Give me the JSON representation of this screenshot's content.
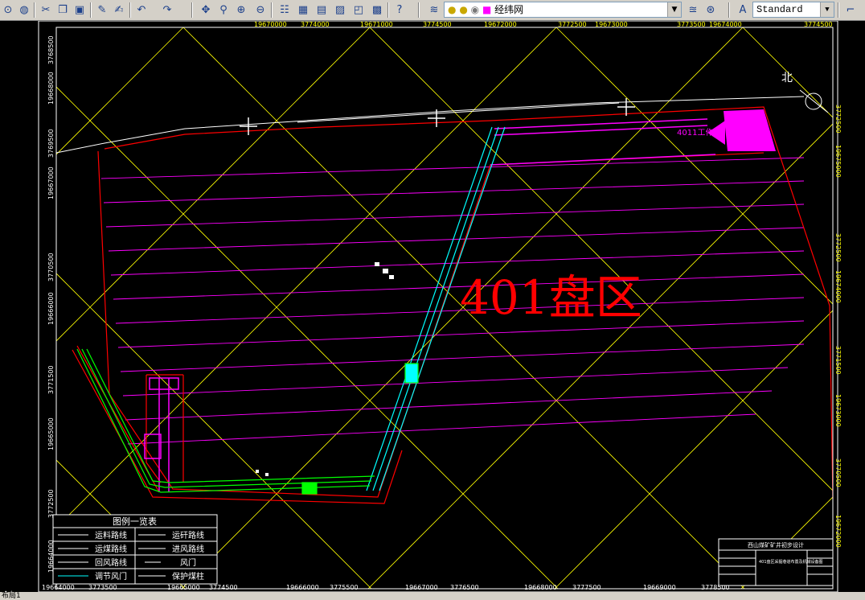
{
  "toolbar": {
    "layer_name": "经纬网",
    "text_style": "Standard",
    "buttons": [
      "open-icon",
      "globe-icon",
      "cut-icon",
      "copy-icon",
      "paste-icon",
      "matchprop-icon",
      "brush-icon",
      "undo-icon",
      "redo-icon",
      "pan-icon",
      "zoom-realtime-icon",
      "zoom-window-icon",
      "zoom-previous-icon",
      "properties-icon",
      "designcenter-icon",
      "toolpalette-icon",
      "sheetset-icon",
      "markup-icon",
      "calculator-icon",
      "help-icon",
      "layer-manager-icon",
      "layer-prev-icon",
      "layer-state-icon",
      "text-style-icon"
    ]
  },
  "drawing": {
    "district_label": "401盘区",
    "north_label": "北",
    "working_face_label": "4011工作面",
    "top_coords": [
      "19670000",
      "3774000",
      "19671000",
      "3774500",
      "19672000",
      "3772500",
      "19673000",
      "3773500",
      "19674000",
      "3774500"
    ],
    "bottom_coords": [
      "19664000",
      "3773500",
      "19665000",
      "3774500",
      "19666000",
      "3775500",
      "19667000",
      "3776500",
      "19668000",
      "3777500",
      "19669000",
      "3778500"
    ],
    "left_coords": [
      "3768500",
      "19668000",
      "3769500",
      "19667000",
      "3770500",
      "19666000",
      "3771500",
      "19665000",
      "3772500",
      "19664000"
    ],
    "right_coords": [
      "3772500",
      "19675000",
      "3772500",
      "19674000",
      "3771500",
      "19673000",
      "3770500",
      "19672000"
    ],
    "legend": {
      "title": "图例一览表",
      "rows": [
        [
          "运料路线",
          "运矸路线"
        ],
        [
          "运煤路线",
          "进风路线"
        ],
        [
          "回风路线",
          "风门"
        ],
        [
          "调节风门",
          "保护煤柱"
        ]
      ]
    },
    "title_block": {
      "project": "西山煤矿矿井初步设计",
      "drawing_title": "401盘区采掘巷道布置及机械设备图"
    }
  },
  "statusbar": {
    "layout_tab": "布局1"
  },
  "colors": {
    "background": "#000000",
    "grid": "#ffff00",
    "boundary": "#ff0000",
    "panel_lines": "#ff00ff",
    "roadway_cyan": "#00ffff",
    "roadway_green": "#00ff00",
    "text_red": "#ff0000",
    "frame": "#ffffff"
  }
}
